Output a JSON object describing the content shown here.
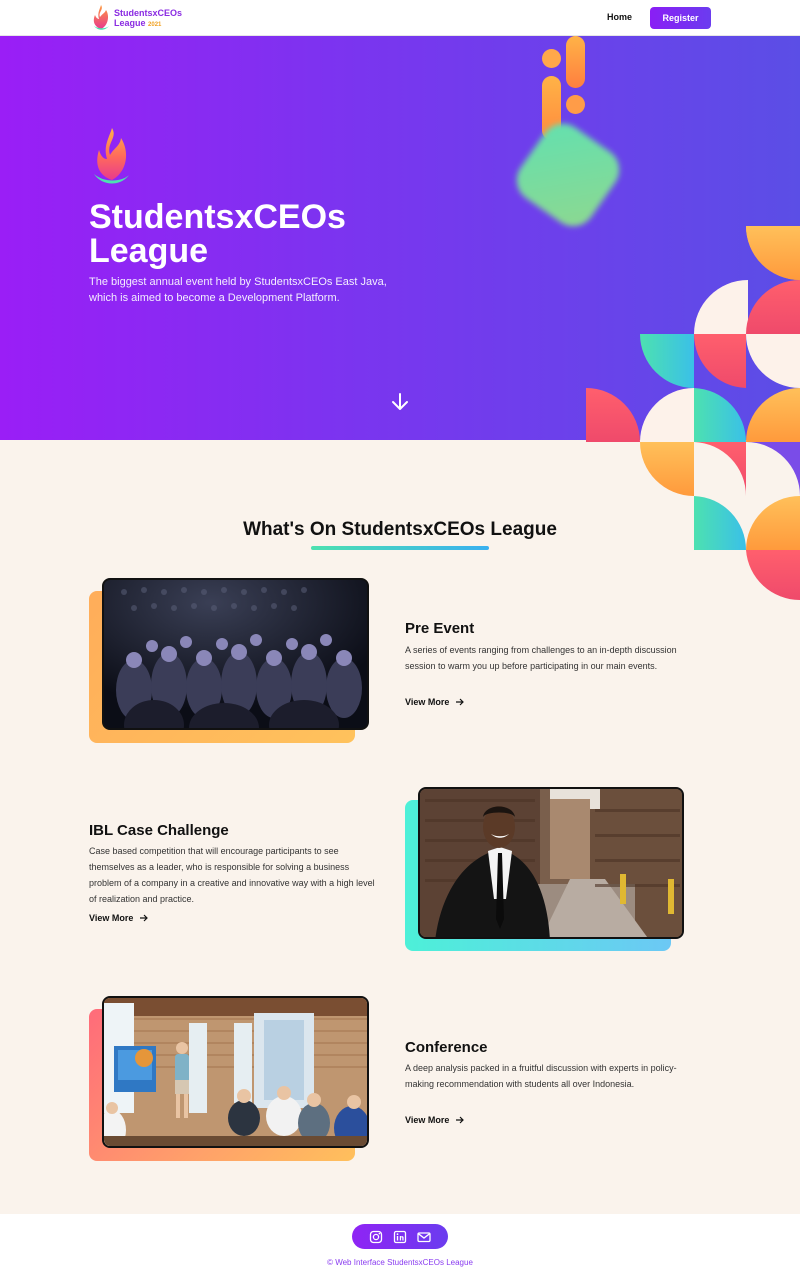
{
  "nav": {
    "brand_line1": "StudentsxCEOs",
    "brand_line2": "League",
    "brand_year": "2021",
    "home_label": "Home",
    "register_label": "Register"
  },
  "hero": {
    "title": "StudentsxCEOs League",
    "subtitle": "The biggest annual event held by StudentsxCEOs East Java, which is aimed to become a Development Platform."
  },
  "section": {
    "title": "What's On StudentsxCEOs League"
  },
  "events": [
    {
      "title": "Pre Event",
      "description": "A series of events ranging from challenges to an in-depth discussion session to warm you up before participating in our main events.",
      "link_label": "View More"
    },
    {
      "title": "IBL Case Challenge",
      "description": "Case based competition that will encourage participants to see themselves as a leader, who is responsible for solving a business problem of a company in a creative and innovative way with a high level of realization and practice.",
      "link_label": "View More"
    },
    {
      "title": "Conference",
      "description": "A deep analysis packed in a fruitful discussion with experts in policy-making recommendation with students all over Indonesia.",
      "link_label": "View More"
    }
  ],
  "footer": {
    "copyright": "© Web Interface StudentsxCEOs League",
    "social_icons": [
      "instagram-icon",
      "linkedin-icon",
      "mail-icon"
    ]
  },
  "colors": {
    "primary": "#8a1ef5",
    "secondary": "#5b4ee6",
    "accent_orange": "#ffb347",
    "accent_teal": "#4de1b0",
    "accent_red": "#f2545b",
    "background": "#faf3ec"
  }
}
